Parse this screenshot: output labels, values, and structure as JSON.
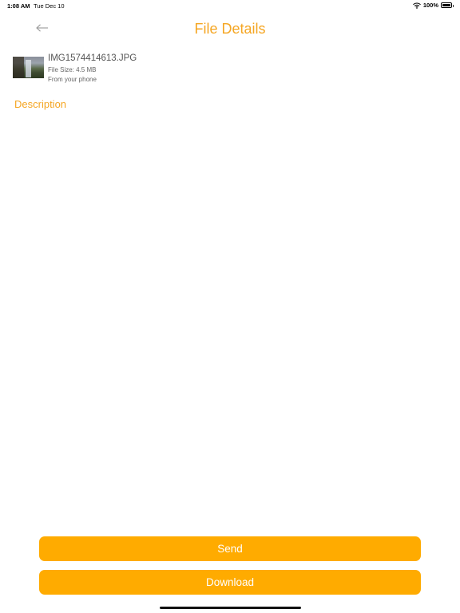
{
  "status_bar": {
    "time": "1:08 AM",
    "date": "Tue Dec 10",
    "battery": "100%"
  },
  "header": {
    "title": "File Details",
    "back_icon": "arrow-left-icon"
  },
  "file": {
    "name": "IMG1574414613.JPG",
    "size": "File Size: 4.5 MB",
    "source": "From your phone"
  },
  "description": {
    "label": "Description",
    "value": ""
  },
  "actions": {
    "send_label": "Send",
    "download_label": "Download"
  },
  "colors": {
    "accent": "#f5a623",
    "button": "#ffab00"
  }
}
